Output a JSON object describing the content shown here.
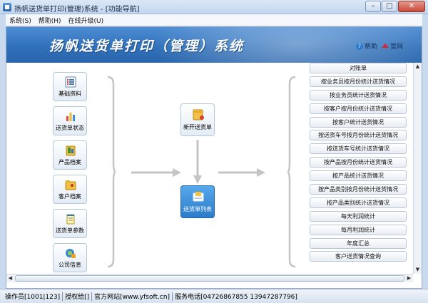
{
  "window": {
    "title": "扬帆送货单打印(管理)系统 - [功能导航]",
    "controls": {
      "minimize": "–",
      "maximize": "□",
      "close": "✕"
    }
  },
  "menu": [
    {
      "label": "系统(S)"
    },
    {
      "label": "帮助(H)"
    },
    {
      "label": "在线升级(U)"
    }
  ],
  "banner": {
    "title": "扬帆送货单打印（管理）系统",
    "help_label": "帮助",
    "website_label": "官网"
  },
  "left_buttons": [
    {
      "label": "基础资料",
      "icon": "list-icon"
    },
    {
      "label": "送货单状态",
      "icon": "bar-chart-icon"
    },
    {
      "label": "产品档案",
      "icon": "folder-icon"
    },
    {
      "label": "客户档案",
      "icon": "folder-contacts-icon"
    },
    {
      "label": "送货单参数",
      "icon": "notepad-icon"
    },
    {
      "label": "公司信息",
      "icon": "company-info-icon"
    }
  ],
  "center": {
    "new_label": "新开送货单",
    "list_label": "送货单列表"
  },
  "right_buttons": [
    "对账单",
    "按业务员按月份统计送货情况",
    "按业务员统计送货情况",
    "按客户按月份统计送货情况",
    "按客户统计送货情况",
    "按送货车号按月份统计送货情况",
    "按送货车号统计送货情况",
    "按产品按月份统计送货情况",
    "按产品统计送货情况",
    "按产品类别按月份统计送货情况",
    "按产品类别统计送货情况",
    "每天利润统计",
    "每月利润统计",
    "年度汇总",
    "客户送货情况查询"
  ],
  "status_bar": {
    "operator": "操作员[1001|123]",
    "license": "授权给[]",
    "website": "官方网站[www.yfsoft.cn]",
    "phone": "服务电话[04726867855 13947287796]"
  },
  "colors": {
    "banner": "#2f6fb8",
    "selected_button": "#2b7cc9",
    "flow_arrow": "#c4c4c4"
  }
}
